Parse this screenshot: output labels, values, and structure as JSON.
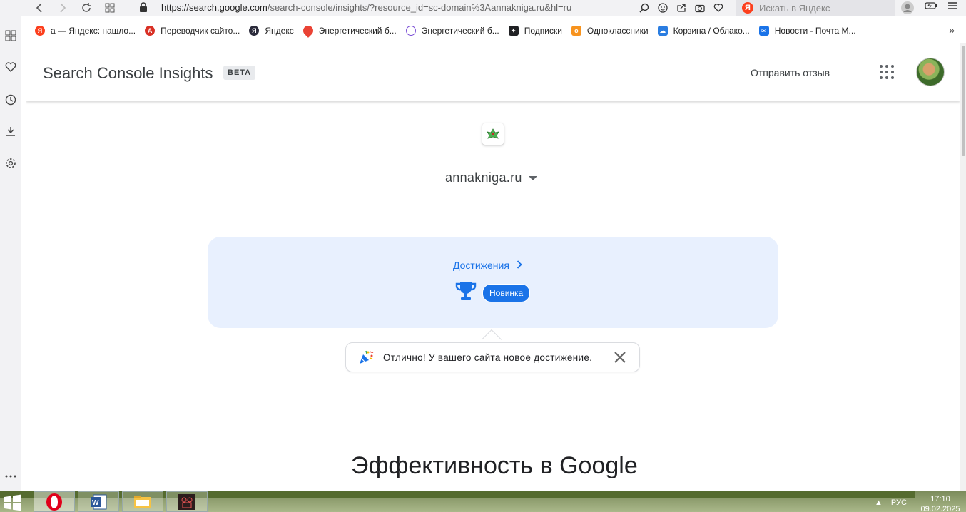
{
  "browser": {
    "url_host": "https://search.google.com",
    "url_path": "/search-console/insights/?resource_id=sc-domain%3Aannakniga.ru&hl=ru",
    "search_placeholder": "Искать в Яндекс",
    "bookmarks": [
      {
        "label": "а — Яндекс: нашло...",
        "icon": "yandex-icon",
        "color": "#fc3f1d"
      },
      {
        "label": "Переводчик сайто...",
        "icon": "translator-icon",
        "color": "#d93025"
      },
      {
        "label": "Яндекс",
        "icon": "yandex-icon",
        "color": "#2b2b3b"
      },
      {
        "label": "Энергетический б...",
        "icon": "map-pin-icon",
        "color": "#ea4335"
      },
      {
        "label": "Энергетический б...",
        "icon": "globe-icon",
        "color": "#7b4fd6"
      },
      {
        "label": "Подписки",
        "icon": "plus-icon",
        "color": "#202124"
      },
      {
        "label": "Одноклассники",
        "icon": "ok-icon",
        "color": "#f7931e"
      },
      {
        "label": "Корзина / Облако...",
        "icon": "cloud-icon",
        "color": "#2a7de1"
      },
      {
        "label": "Новости - Почта М...",
        "icon": "mail-icon",
        "color": "#1a73e8"
      }
    ]
  },
  "header": {
    "title": "Search Console Insights",
    "badge": "BETA",
    "feedback_label": "Отправить отзыв"
  },
  "property": {
    "domain": "annakniga.ru"
  },
  "achievements": {
    "link_label": "Достижения",
    "new_badge": "Новинка"
  },
  "toast": {
    "message": "Отлично! У вашего сайта новое достижение."
  },
  "section": {
    "title": "Эффективность в Google"
  },
  "taskbar": {
    "language": "РУС",
    "time": "17:10",
    "date": "09.02.2025"
  },
  "colors": {
    "accent": "#1a73e8",
    "card_bg": "#e8f0fe"
  }
}
